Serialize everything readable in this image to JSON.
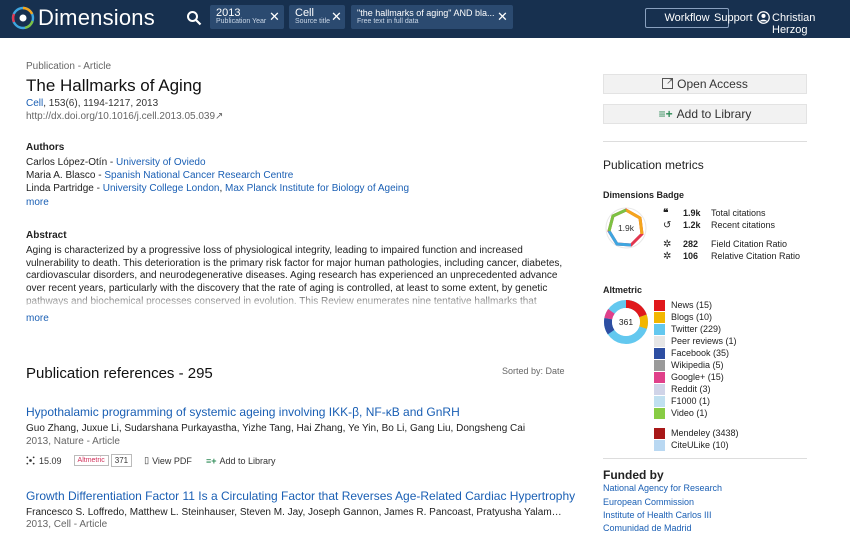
{
  "header": {
    "logo_text": "Dimensions",
    "chips": [
      {
        "main": "2013",
        "sub": "Publication Year"
      },
      {
        "main": "Cell",
        "sub": "Source title"
      },
      {
        "main": "\"the hallmarks of aging\" AND bla...",
        "sub": "Free text in full data"
      }
    ],
    "workflow_label": "Workflow",
    "support_label": "Support",
    "user_name": "Christian Herzog"
  },
  "article": {
    "breadcrumb": "Publication - Article",
    "title": "The Hallmarks of Aging",
    "journal": "Cell",
    "citation": ", 153(6), 1194-1217, 2013",
    "doi": "http://dx.doi.org/10.1016/j.cell.2013.05.039↗",
    "authors_heading": "Authors",
    "authors": [
      {
        "name": "Carlos López-Otín",
        "sep": " - ",
        "aff1": "University of Oviedo",
        "aff2": ""
      },
      {
        "name": "Maria A. Blasco",
        "sep": " - ",
        "aff1": "Spanish National Cancer Research Centre",
        "aff2": ""
      },
      {
        "name": "Linda Partridge",
        "sep": " - ",
        "aff1": "University College London",
        "aff2": "Max Planck Institute for Biology of Ageing"
      }
    ],
    "more_label": "more",
    "abstract_heading": "Abstract",
    "abstract": "Aging is characterized by a progressive loss of physiological integrity, leading to impaired function and increased vulnerability to death. This deterioration is the primary risk factor for major human pathologies, including cancer, diabetes, cardiovascular disorders, and neurodegenerative diseases. Aging research has experienced an unprecedented advance over recent years, particularly with the discovery that the rate of aging is controlled, at least to some extent, by genetic pathways and biochemical processes conserved in evolution. This Review enumerates nine tentative hallmarks that represent common denominators of aging in different organisms, with"
  },
  "references": {
    "heading": "Publication references - 295",
    "sorted_by": "Sorted by: Date",
    "items": [
      {
        "title": "Hypothalamic programming of systemic ageing involving IKK-β, NF-κB and GnRH",
        "authors": "Guo Zhang, Juxue Li, Sudarshana Purkayastha, Yizhe Tang, Hai Zhang, Ye Yin, Bo Li, Gang Liu, Dongsheng Cai",
        "meta": "2013, Nature - Article",
        "fcr": "15.09",
        "altmetric_label": "Altmetric",
        "altmetric_score": "371",
        "view_pdf": "View PDF",
        "add_library": "Add to Library"
      },
      {
        "title": "Growth Differentiation Factor 11 Is a Circulating Factor that Reverses Age-Related Cardiac Hypertrophy",
        "authors": "Francesco S. Loffredo, Matthew L. Steinhauser, Steven M. Jay, Joseph Gannon, James R. Pancoast, Pratyusha Yalamanchi, Manisha Si...",
        "meta": "2013, Cell - Article"
      }
    ]
  },
  "sidebar": {
    "open_access": "Open Access",
    "add_to_library": "Add to Library",
    "metrics_heading": "Publication metrics",
    "badge_heading": "Dimensions Badge",
    "badge_value": "1.9k",
    "metrics": [
      {
        "value": "1.9k",
        "label": "Total citations"
      },
      {
        "value": "1.2k",
        "label": "Recent citations"
      },
      {
        "value": "282",
        "label": "Field Citation Ratio"
      },
      {
        "value": "106",
        "label": "Relative Citation Ratio"
      }
    ],
    "altmetric_heading": "Altmetric",
    "altmetric_score": "361",
    "altmetric_sources": [
      {
        "label": "News (15)",
        "color": "#e0181c"
      },
      {
        "label": "Blogs (10)",
        "color": "#f2b600"
      },
      {
        "label": "Twitter (229)",
        "color": "#63c8ef"
      },
      {
        "label": "Peer reviews (1)",
        "color": "#e6e6e6"
      },
      {
        "label": "Facebook (35)",
        "color": "#2d4ea2"
      },
      {
        "label": "Wikipedia (5)",
        "color": "#9a9a9a"
      },
      {
        "label": "Google+ (15)",
        "color": "#e0408a"
      },
      {
        "label": "Reddit (3)",
        "color": "#d0d4e8"
      },
      {
        "label": "F1000 (1)",
        "color": "#c0e0f0"
      },
      {
        "label": "Video (1)",
        "color": "#88cc44"
      },
      {
        "label": "Mendeley (3438)",
        "color": "#a81818"
      },
      {
        "label": "CiteULike (10)",
        "color": "#b9d8f2"
      }
    ],
    "funded_heading": "Funded by",
    "funders": [
      "National Agency for Research",
      "European Commission",
      "Institute of Health Carlos III",
      "Comunidad de Madrid"
    ]
  }
}
